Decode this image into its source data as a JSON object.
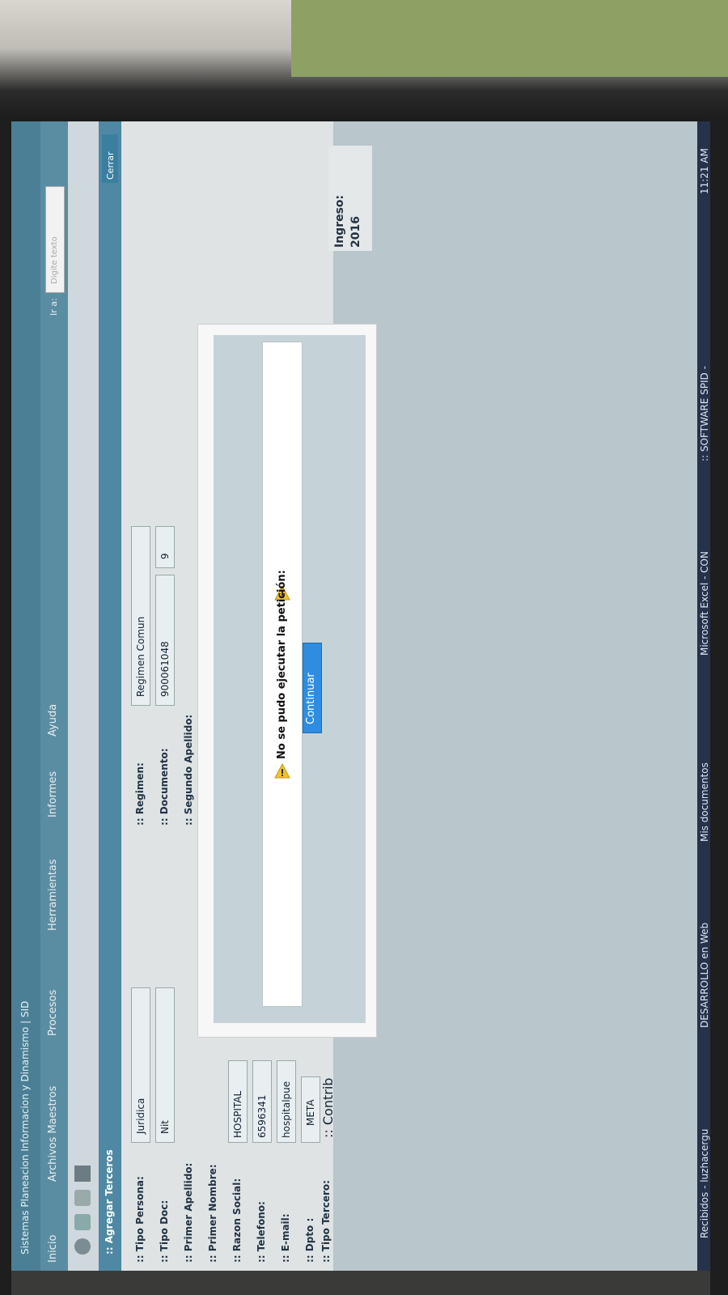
{
  "app": {
    "title": "Sistemas Planeacion Informacion y Dinamismo | SID",
    "menu": [
      "Inicio",
      "Archivos Maestros",
      "Procesos",
      "Herramientas",
      "Informes",
      "Ayuda"
    ],
    "go_to_label": "Ir a:",
    "go_to_placeholder": "Digite texto",
    "year_label": "Ingreso:",
    "year_value": "2016",
    "year_label2": "Ingreso:"
  },
  "form": {
    "title": ":: Agregar Terceros",
    "close_label": "Cerrar",
    "fields": [
      {
        "label": ":: Tipo Persona:",
        "value": "Juridica"
      },
      {
        "label": ":: Tipo Doc:",
        "value": "Nit"
      },
      {
        "label": ":: Primer Apellido:",
        "value": ""
      },
      {
        "label": ":: Primer Nombre:",
        "value": ""
      },
      {
        "label": ":: Razon Social:",
        "value": "HOSPITAL"
      },
      {
        "label": ":: Telefono:",
        "value": "6596341"
      },
      {
        "label": ":: E-mail:",
        "value": "hospitalpue"
      },
      {
        "label": ":: Dpto :",
        "value": "META"
      },
      {
        "label": ":: Tipo Tercero:",
        "value": ":: Contrib"
      }
    ],
    "right_fields": [
      {
        "label": ":: Regimen:",
        "value": "Regimen Comun"
      },
      {
        "label": ":: Documento:",
        "value": "900061048"
      },
      {
        "label": ":: Segundo Apellido:",
        "value": ""
      }
    ],
    "doc_check": "9"
  },
  "dialog": {
    "message": "No se pudo ejecutar la petición:",
    "button_label": "Continuar"
  },
  "taskbar": {
    "items": [
      "Recibidos - luzhacergu",
      "DESARROLLO en Web",
      "Mis documentos",
      "Microsoft Excel - CON",
      ":: SOFTWARE SPID -"
    ],
    "clock": "11:21 AM"
  },
  "colors": {
    "header": "#4b7f96",
    "dialog_bg": "#c5d3d9",
    "button": "#2f8de0",
    "warning": "#f2c230"
  }
}
